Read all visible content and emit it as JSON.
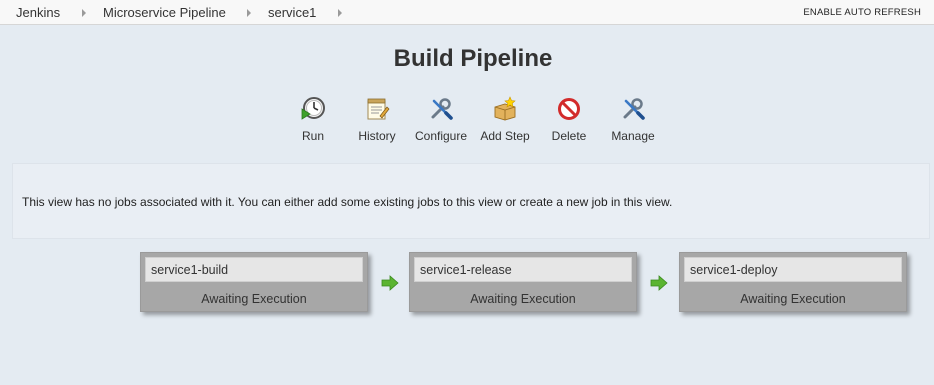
{
  "breadcrumb": [
    {
      "label": "Jenkins"
    },
    {
      "label": "Microservice Pipeline"
    },
    {
      "label": "service1"
    }
  ],
  "auto_refresh_label": "ENABLE AUTO REFRESH",
  "title": "Build Pipeline",
  "toolbar": [
    {
      "label": "Run",
      "icon": "run-clock-icon"
    },
    {
      "label": "History",
      "icon": "notepad-icon"
    },
    {
      "label": "Configure",
      "icon": "wrench-screwdriver-icon"
    },
    {
      "label": "Add Step",
      "icon": "package-star-icon"
    },
    {
      "label": "Delete",
      "icon": "no-entry-icon"
    },
    {
      "label": "Manage",
      "icon": "wrench-screwdriver-icon"
    }
  ],
  "info_message": "This view has no jobs associated with it. You can either add some existing jobs to this view or create a new job in this view.",
  "pipeline": [
    {
      "name": "service1-build",
      "status": "Awaiting Execution"
    },
    {
      "name": "service1-release",
      "status": "Awaiting Execution"
    },
    {
      "name": "service1-deploy",
      "status": "Awaiting Execution"
    }
  ],
  "colors": {
    "background": "#e4ebf2",
    "stage_box": "#a7a7a7",
    "arrow_green": "#5bb431",
    "delete_red": "#d22b2b"
  }
}
